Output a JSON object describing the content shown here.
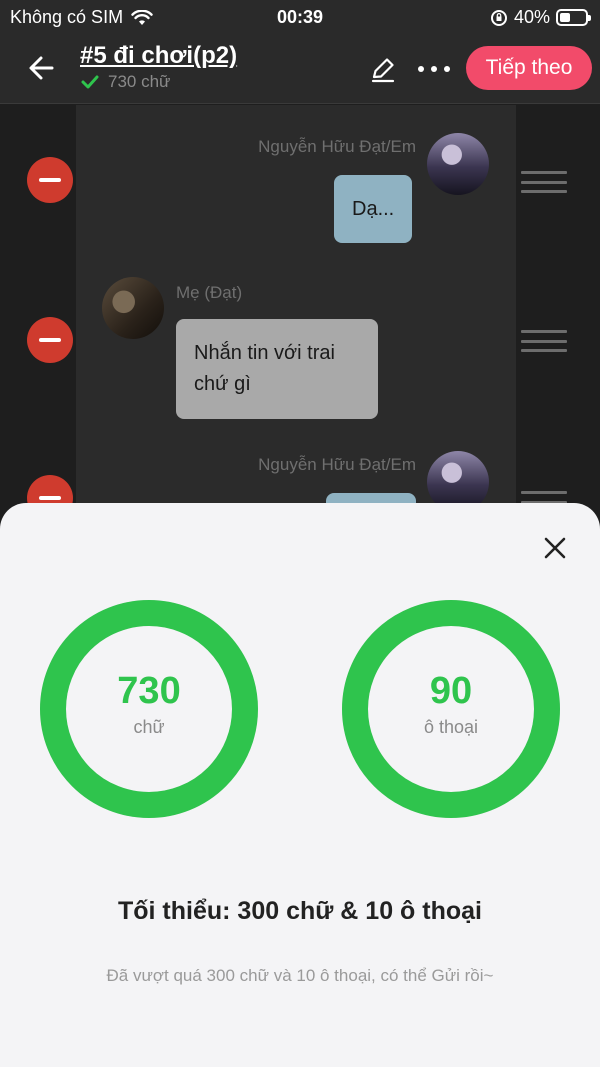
{
  "status_bar": {
    "carrier": "Không có SIM",
    "time": "00:39",
    "battery_text": "40%",
    "battery_level": 0.4
  },
  "header": {
    "title": "#5 đi chơi(p2)",
    "word_count_label": "730 chữ",
    "next_label": "Tiếp theo"
  },
  "messages": [
    {
      "sender": "Nguyễn Hữu Đạt/Em",
      "text": "Dạ...",
      "side": "right"
    },
    {
      "sender": "Mẹ (Đạt)",
      "text": "Nhắn tin với trai chứ gì",
      "side": "left"
    },
    {
      "sender": "Nguyễn Hữu Đạt/Em",
      "text": "",
      "side": "right"
    }
  ],
  "stats": {
    "words": {
      "value": "730",
      "label": "chữ",
      "progress": 1.0
    },
    "dialogues": {
      "value": "90",
      "label": "ô thoại",
      "progress": 1.0
    },
    "minimum": "Tối thiểu: 300 chữ & 10 ô thoại",
    "hint": "Đã vượt quá 300 chữ và 10 ô thoại, có thể Gửi rồi~"
  },
  "colors": {
    "accent": "#f24b6a",
    "success": "#2fc44d",
    "remove": "#cf3b2e",
    "bubble_right": "#8fb2c2",
    "bubble_left": "#a9a9a9"
  },
  "icons": [
    "wifi-icon",
    "rotation-lock-icon",
    "battery-icon",
    "back-arrow-icon",
    "check-icon",
    "pencil-icon",
    "more-icon",
    "remove-icon",
    "drag-handle-icon",
    "close-icon"
  ]
}
